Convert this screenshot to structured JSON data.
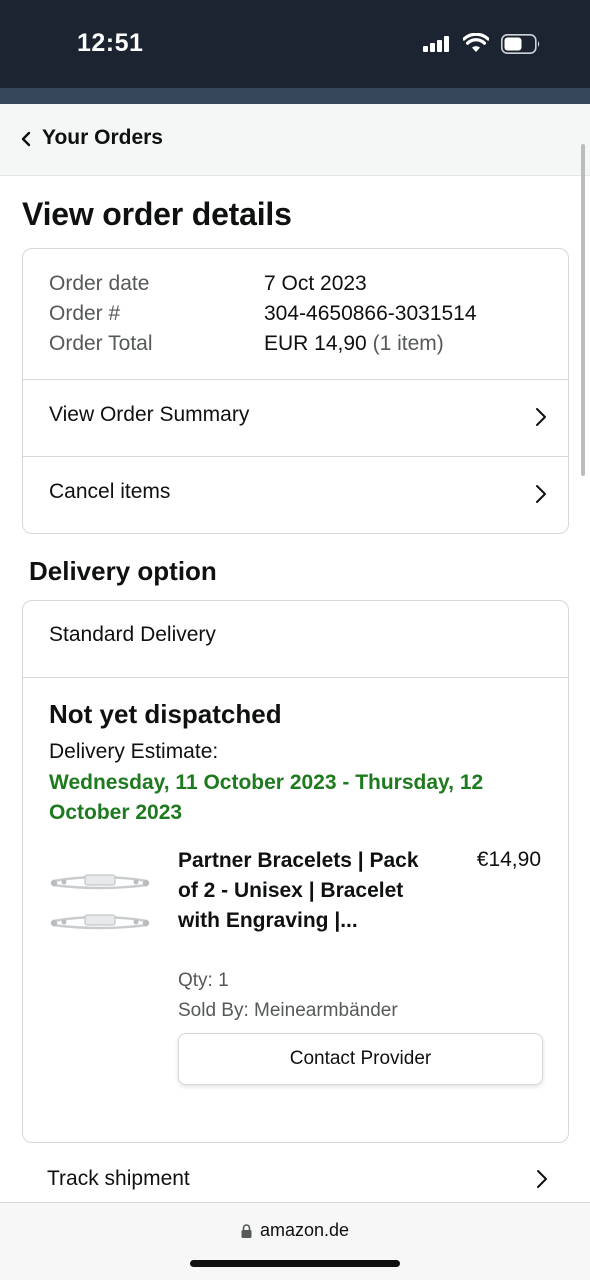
{
  "status_bar": {
    "time": "12:51"
  },
  "header": {
    "back_label": "Your Orders"
  },
  "page": {
    "title": "View order details"
  },
  "order": {
    "date_label": "Order date",
    "date_value": "7 Oct 2023",
    "number_label": "Order #",
    "number_value": "304-4650866-3031514",
    "total_label": "Order Total",
    "total_value": "EUR 14,90",
    "total_items": "(1 item)",
    "links": [
      {
        "label": "View Order Summary"
      },
      {
        "label": "Cancel items"
      }
    ]
  },
  "delivery": {
    "section_title": "Delivery option",
    "method": "Standard Delivery",
    "status": "Not yet dispatched",
    "estimate_label": "Delivery Estimate:",
    "estimate_dates": "Wednesday, 11 October 2023 - Thursday, 12 October 2023",
    "estimate_color": "#1e7a1e",
    "item": {
      "title": "Partner Bracelets | Pack of 2 - Unisex | Bracelet with Engraving |...",
      "price": "€14,90",
      "qty": "Qty: 1",
      "seller": "Sold By: Meinearmbänder",
      "contact_label": "Contact Provider"
    }
  },
  "track": {
    "label": "Track shipment"
  },
  "browser": {
    "url": "amazon.de"
  }
}
